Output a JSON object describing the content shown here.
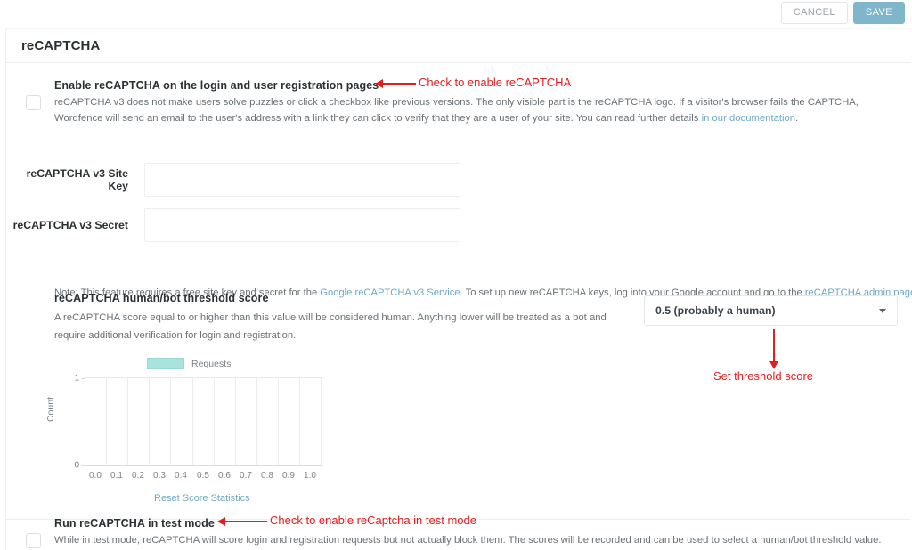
{
  "toolbar": {
    "cancel_label": "CANCEL",
    "save_label": "SAVE"
  },
  "panel": {
    "title": "reCAPTCHA"
  },
  "enable_section": {
    "label": "Enable reCAPTCHA on the login and user registration pages",
    "description_before_link": "reCAPTCHA v3 does not make users solve puzzles or click a checkbox like previous versions. The only visible part is the reCAPTCHA logo. If a visitor's browser fails the CAPTCHA, Wordfence will send an email to the user's address with a link they can click to verify that they are a user of your site. You can read further details ",
    "description_link": "in our documentation",
    "description_after_link": ".",
    "fields": [
      {
        "label": "reCAPTCHA v3 Site Key",
        "value": "",
        "placeholder": ""
      },
      {
        "label": "reCAPTCHA v3 Secret",
        "value": "",
        "placeholder": ""
      }
    ],
    "note_part1": "Note: This feature requires a free site key and secret for the ",
    "note_link1": "Google reCAPTCHA v3 Service",
    "note_part2": ". To set up new reCAPTCHA keys, log into your Google account and go to the ",
    "note_link2": "reCAPTCHA admin page",
    "note_part3": "."
  },
  "threshold_section": {
    "label": "reCAPTCHA human/bot threshold score",
    "description": "A reCAPTCHA score equal to or higher than this value will be considered human. Anything lower will be treated as a bot and require additional verification for login and registration.",
    "selected_option": "0.5 (probably a human)",
    "reset_link": "Reset Score Statistics"
  },
  "testmode_section": {
    "label": "Run reCAPTCHA in test mode",
    "description": "While in test mode, reCAPTCHA will score login and registration requests but not actually block them. The scores will be recorded and can be used to select a human/bot threshold value."
  },
  "annotations": [
    {
      "text": "Check to enable reCAPTCHA"
    },
    {
      "text": "Set threshold score"
    },
    {
      "text": "Check to enable reCaptcha in test mode"
    }
  ],
  "colors": {
    "save_button": "#7fb6cc",
    "link": "#6fa8c4",
    "annotation": "#e02020",
    "legend_swatch": "#a9e3de"
  },
  "chart_data": {
    "type": "bar",
    "title": "",
    "xlabel": "",
    "ylabel": "Count",
    "categories": [
      "0.0",
      "0.1",
      "0.2",
      "0.3",
      "0.4",
      "0.5",
      "0.6",
      "0.7",
      "0.8",
      "0.9",
      "1.0"
    ],
    "values": [
      0,
      0,
      0,
      0,
      0,
      0,
      0,
      0,
      0,
      0,
      0
    ],
    "series": [
      {
        "name": "Requests",
        "values": [
          0,
          0,
          0,
          0,
          0,
          0,
          0,
          0,
          0,
          0,
          0
        ]
      }
    ],
    "yticks": [
      "0",
      "1"
    ],
    "ylim": [
      0,
      1
    ],
    "grid": true,
    "legend": "Requests",
    "legend_position": "top"
  }
}
